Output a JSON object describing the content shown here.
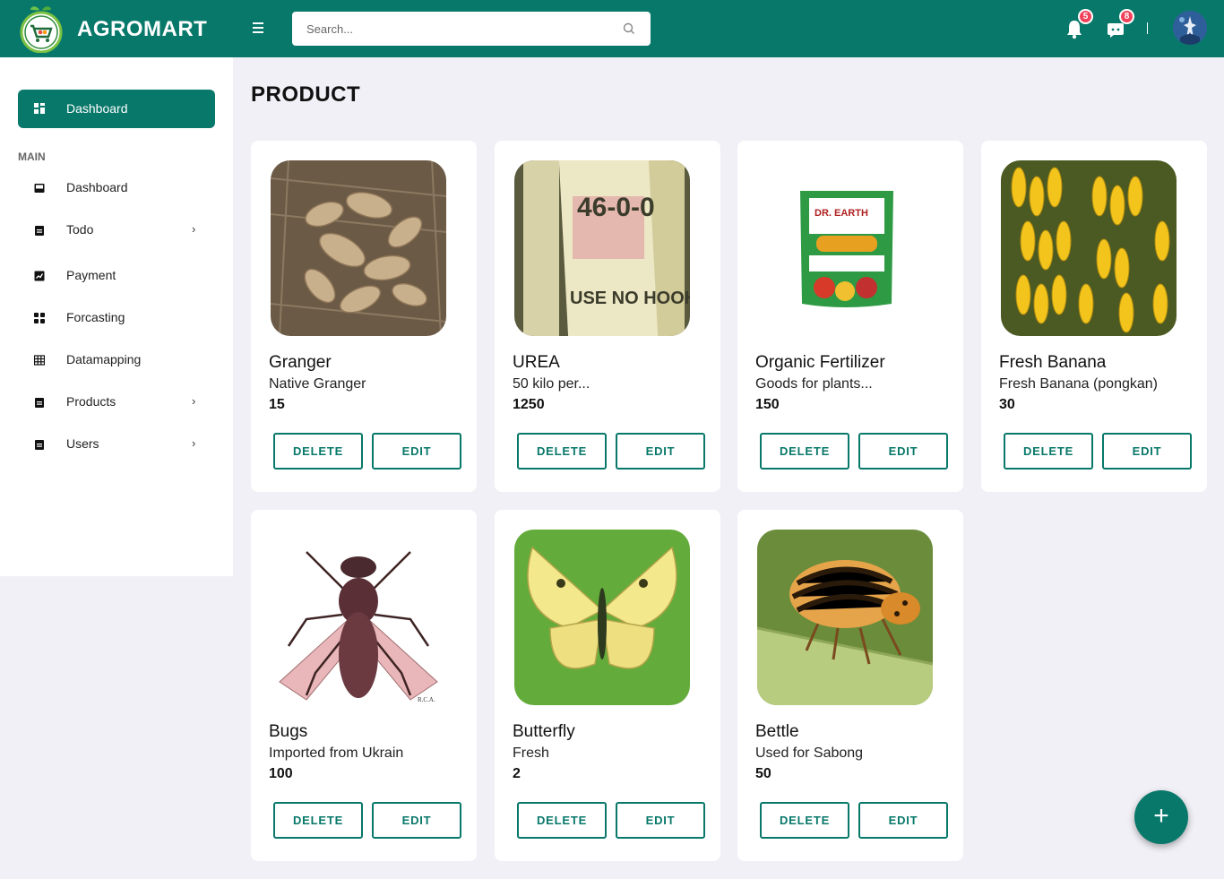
{
  "app": {
    "brand": "AGROMART"
  },
  "search": {
    "placeholder": "Search..."
  },
  "header": {
    "notifications_count": "5",
    "messages_count": "8"
  },
  "sidebar": {
    "active": {
      "label": "Dashboard",
      "icon": "dashboard-icon"
    },
    "section_heading": "MAIN",
    "items": [
      {
        "label": "Dashboard",
        "icon": "inbox-icon",
        "chevron": ""
      },
      {
        "label": "Todo",
        "icon": "clipboard-icon",
        "chevron": "›"
      },
      {
        "label": "Payment",
        "icon": "chart-icon",
        "chevron": ""
      },
      {
        "label": "Forcasting",
        "icon": "grid-icon",
        "chevron": ""
      },
      {
        "label": "Datamapping",
        "icon": "table-icon",
        "chevron": ""
      },
      {
        "label": "Products",
        "icon": "clipboard-icon",
        "chevron": "›"
      },
      {
        "label": "Users",
        "icon": "clipboard-icon",
        "chevron": "›"
      }
    ]
  },
  "page": {
    "title": "PRODUCT"
  },
  "products": [
    {
      "name": "Granger",
      "description": "Native Granger",
      "quantity": "15",
      "image": "ginger-photo",
      "delete_label": "DELETE",
      "edit_label": "EDIT"
    },
    {
      "name": "UREA",
      "description": "50 kilo per...",
      "quantity": "1250",
      "image": "urea-sack-photo",
      "delete_label": "DELETE",
      "edit_label": "EDIT"
    },
    {
      "name": "Organic Fertilizer",
      "description": "Goods for plants...",
      "quantity": "150",
      "image": "fertilizer-bag-photo",
      "delete_label": "DELETE",
      "edit_label": "EDIT"
    },
    {
      "name": "Fresh Banana",
      "description": "Fresh Banana (pongkan)",
      "quantity": "30",
      "image": "banana-photo",
      "delete_label": "DELETE",
      "edit_label": "EDIT"
    },
    {
      "name": "Bugs",
      "description": "Imported from Ukrain",
      "quantity": "100",
      "image": "fly-illustration",
      "delete_label": "DELETE",
      "edit_label": "EDIT"
    },
    {
      "name": "Butterfly",
      "description": "Fresh",
      "quantity": "2",
      "image": "butterfly-photo",
      "delete_label": "DELETE",
      "edit_label": "EDIT"
    },
    {
      "name": "Bettle",
      "description": "Used for Sabong",
      "quantity": "50",
      "image": "beetle-photo",
      "delete_label": "DELETE",
      "edit_label": "EDIT"
    }
  ],
  "fab": {
    "label": "+"
  },
  "colors": {
    "primary": "#08786a",
    "background": "#f0f0f6",
    "badge": "#f0425a"
  }
}
